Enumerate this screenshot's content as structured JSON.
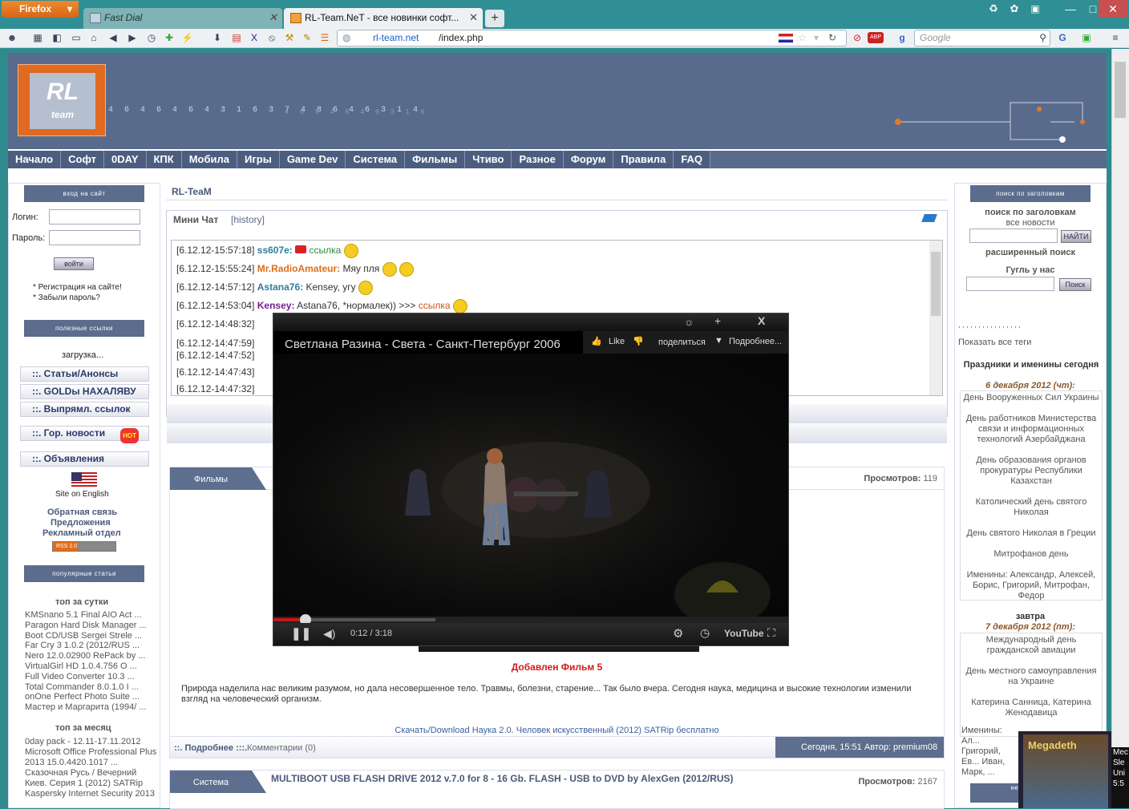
{
  "browser": {
    "menu_label": "Firefox",
    "tabs": [
      {
        "title": "Fast Dial"
      },
      {
        "title": "RL-Team.NeT - все новинки софт..."
      }
    ],
    "url_host": "rl-team.net",
    "url_path": "/index.php",
    "search_placeholder": "Google"
  },
  "menu": [
    "Начало",
    "Софт",
    "0DAY",
    "КПК",
    "Мобила",
    "Игры",
    "Game Dev",
    "Система",
    "Фильмы",
    "Чтиво",
    "Разное",
    "Форум",
    "Правила",
    "FAQ"
  ],
  "left": {
    "login_header": "вход на сайт",
    "login_label": "Логин:",
    "password_label": "Пароль:",
    "login_button": "войти",
    "register": "* Регистрация на сайте!",
    "forgot": "* Забыли пароль?",
    "links_header": "полезные ссылки",
    "loading": "загрузка...",
    "links": [
      "::. Статьи/Анонсы",
      "::. GOLDы НАХАЛЯВУ",
      "::. Выпрямл. ссылок",
      "::. Гор. новости",
      "::. Объявления"
    ],
    "hot": "HOT",
    "english": "Site on English",
    "feedback": "Обратная связь",
    "proposals": "Предложения",
    "ads": "Рекламный отдел",
    "rss": "RSS 2.0",
    "popular_header": "популярные статьи",
    "day_title": "топ за сутки",
    "day_items": [
      "KMSnano 5.1 Final AIO Act ...",
      "Paragon Hard Disk Manager ...",
      "Boot CD/USB Sergei Strele ...",
      "Far Cry 3 1.0.2 (2012/RUS ...",
      "Nero 12.0.02900 RePack by ...",
      "VirtualGirl HD 1.0.4.756 O ...",
      "Full Video Converter 10.3 ...",
      "Total Commander 8.0.1.0 I ...",
      "onOne Perfect Photo Suite ...",
      "Мастер и Маргарита (1994/ ..."
    ],
    "month_title": "топ за месяц",
    "month_items": [
      "0day pack - 12.11-17.11.2012",
      "Microsoft Office Professional Plus",
      "2013 15.0.4420.1017 ...",
      "Сказочная Русь / Вечерний",
      "Киев. Серия 1 (2012) SATRip",
      "Kaspersky Internet Security 2013"
    ]
  },
  "main": {
    "site_name": "RL-TeaM",
    "chat_title": "Мини Чат",
    "chat_history": "[history]",
    "chat": [
      {
        "time": "[6.12.12-15:57:18]",
        "user": "ss607e:",
        "text": "",
        "link": "ссылка"
      },
      {
        "time": "[6.12.12-15:55:24]",
        "user": "Mr.RadioAmateur:",
        "text": "Мяу пля",
        "link": ""
      },
      {
        "time": "[6.12.12-14:57:12]",
        "user": "Astana76:",
        "text": "Kensey, угу",
        "link": ""
      },
      {
        "time": "[6.12.12-14:53:04]",
        "user": "Kensey:",
        "text": "Astana76, *нормалек)) >>>",
        "link": "ссылка"
      },
      {
        "time": "[6.12.12-14:48:32]",
        "user": "",
        "text": "",
        "link": ""
      },
      {
        "time": "[6.12.12-14:47:59]",
        "user": "",
        "text": "",
        "link": ""
      },
      {
        "time": "[6.12.12-14:47:52]",
        "user": "",
        "text": "",
        "link": ""
      },
      {
        "time": "[6.12.12-14:47:43]",
        "user": "",
        "text": "",
        "link": ""
      },
      {
        "time": "[6.12.12-14:47:32]",
        "user": "",
        "text": "",
        "link": ""
      }
    ],
    "post1": {
      "category": "Фильмы",
      "views_label": "Просмотров:",
      "views": "119",
      "headline": "Добавлен Фильм 5",
      "body": "Природа наделила нас великим разумом, но дала несовершенное тело. Травмы, болезни, старение... Так было вчера. Сегодня наука, медицина и высокие технологии изменили взгляд на человеческий организм.",
      "download": "Скачать/Download Наука 2.0. Человек искусственный (2012) SATRip бесплатно",
      "more": "::. Подробнее :::.",
      "comments": "Комментарии (0)",
      "footer": "Сегодня, 15:51  Автор: premium08"
    },
    "post2": {
      "category": "Система",
      "title": "MULTIBOOT USB FLASH DRIVE 2012 v.7.0 for 8 - 16 Gb. FLASH - USB to DVD by AlexGen (2012/RUS)",
      "views_label": "Просмотров:",
      "views": "2167"
    }
  },
  "right": {
    "search_header": "поиск по заголовкам",
    "search_title": "поиск по заголовкам",
    "all_news": "все новости",
    "find_button": "НАЙТИ",
    "advanced": "расширенный поиск",
    "google_title": "Гугль у нас",
    "google_button": "Поиск",
    "tags_dots": ", , , , , , , , , , , , , , , ,",
    "all_tags": "Показать все теги",
    "holidays_title": "Праздники и именины сегодня",
    "today_date": "6 декабря 2012 (чт):",
    "today_items": [
      "День Вооруженных Сил Украины",
      "День работников Министерства связи и информационных технологий Азербайджана",
      "День образования органов прокуратуры Республики Казахстан",
      "Католический день святого Николая",
      "День святого Николая в Греции",
      "Митрофанов день"
    ],
    "today_names": "Именины: Александр, Алексей, Борис, Григорий, Митрофан, Федор",
    "tomorrow_title": "завтра",
    "tomorrow_date": "7 декабря 2012 (пт):",
    "tomorrow_items": [
      "Международный день гражданской авиации",
      "День местного самоуправления на Украине",
      "Катерина Санница, Катерина Женодавица"
    ],
    "tomorrow_names": "Именины: Ал... Григорий, Ев... Иван, Марк, ...",
    "bottom_header": "не п... на ..."
  },
  "video": {
    "title": "Светлана Разина - Света - Санкт-Петербург 2006",
    "like": "Like",
    "share": "поделиться",
    "more": "Подробнее...",
    "time": "0:12 / 3:18",
    "youtube": "YouTube",
    "progress": 0.063
  },
  "player_popup": {
    "artist": "Megadeth",
    "lines": [
      "Mec",
      "Sle",
      "Uni",
      "5:5"
    ]
  }
}
